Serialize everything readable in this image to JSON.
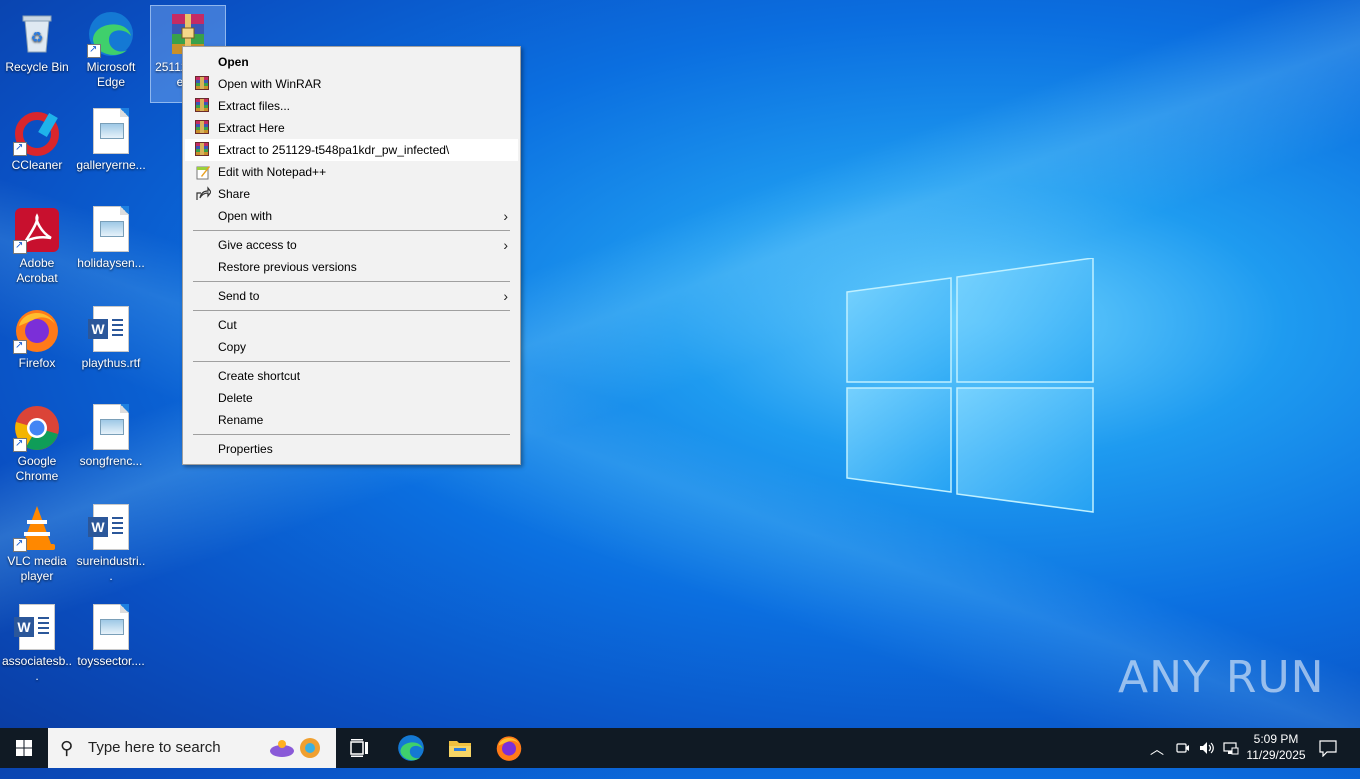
{
  "desktop": {
    "icons": [
      {
        "label": "Recycle Bin"
      },
      {
        "label": "Microsoft Edge"
      },
      {
        "label": "251129-t548pa1kdr_pw_infected"
      },
      {
        "label": "CCleaner"
      },
      {
        "label": "galleryerne..."
      },
      {
        "label": "Adobe Acrobat"
      },
      {
        "label": "holidaysen..."
      },
      {
        "label": "Firefox"
      },
      {
        "label": "playthus.rtf"
      },
      {
        "label": "Google Chrome"
      },
      {
        "label": "songfrenc..."
      },
      {
        "label": "VLC media player"
      },
      {
        "label": "sureindustri..."
      },
      {
        "label": "associatesb..."
      },
      {
        "label": "toyssector...."
      }
    ],
    "selected_label_partial": "25112 a1kdr ecte"
  },
  "context_menu": {
    "items": [
      {
        "label": "Open",
        "icon": "none"
      },
      {
        "label": "Open with WinRAR",
        "icon": "winrar-icon"
      },
      {
        "label": "Extract files...",
        "icon": "winrar-icon"
      },
      {
        "label": "Extract Here",
        "icon": "winrar-icon"
      },
      {
        "label": "Extract to 251129-t548pa1kdr_pw_infected\\",
        "icon": "winrar-icon"
      },
      {
        "label": "Edit with Notepad++",
        "icon": "notepadpp-icon"
      },
      {
        "label": "Share",
        "icon": "share-icon"
      },
      {
        "label": "Open with",
        "icon": "none"
      },
      {
        "label": "Give access to",
        "icon": "none"
      },
      {
        "label": "Restore previous versions",
        "icon": "none"
      },
      {
        "label": "Send to",
        "icon": "none"
      },
      {
        "label": "Cut",
        "icon": "none"
      },
      {
        "label": "Copy",
        "icon": "none"
      },
      {
        "label": "Create shortcut",
        "icon": "none"
      },
      {
        "label": "Delete",
        "icon": "none"
      },
      {
        "label": "Rename",
        "icon": "none"
      },
      {
        "label": "Properties",
        "icon": "none"
      }
    ],
    "submenu_arrow": "›"
  },
  "taskbar": {
    "search_placeholder": "Type here to search",
    "time": "5:09 PM",
    "date": "11/29/2025"
  },
  "watermark": "ANY RUN"
}
